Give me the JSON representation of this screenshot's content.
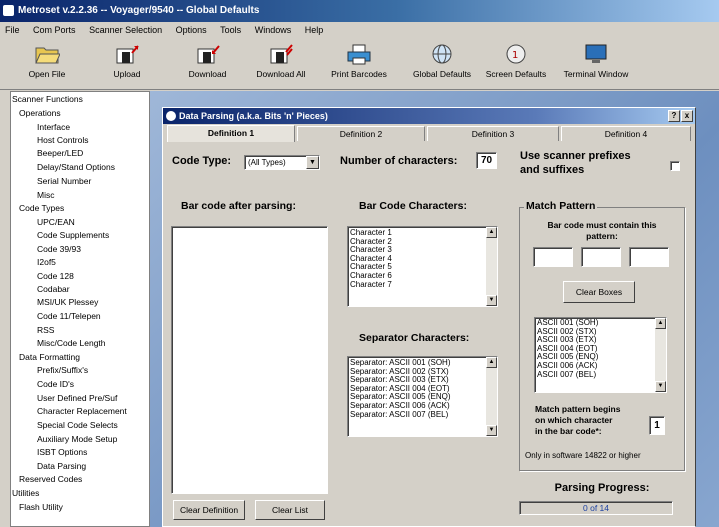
{
  "window": {
    "title": "Metroset v.2.2.36 -- Voyager/9540 -- Global Defaults"
  },
  "menu": [
    "File",
    "Com Ports",
    "Scanner Selection",
    "Options",
    "Tools",
    "Windows",
    "Help"
  ],
  "toolbar": {
    "open_file": "Open File",
    "upload": "Upload",
    "download": "Download",
    "download_all": "Download All",
    "print_barcodes": "Print Barcodes",
    "global_defaults": "Global Defaults",
    "screen_defaults": "Screen Defaults",
    "terminal_window": "Terminal Window"
  },
  "tree": [
    "Scanner Functions",
    "Operations",
    "Interface",
    "Host Controls",
    "Beeper/LED",
    "Delay/Stand Options",
    "Serial Number",
    "Misc",
    "Code Types",
    "UPC/EAN",
    "Code Supplements",
    "Code 39/93",
    "I2of5",
    "Code 128",
    "Codabar",
    "MSI/UK Plessey",
    "Code 11/Telepen",
    "RSS",
    "Misc/Code Length",
    "Data Formatting",
    "Prefix/Suffix's",
    "Code ID's",
    "User Defined Pre/Suf",
    "Character Replacement",
    "Special Code Selects",
    "Auxiliary Mode Setup",
    "ISBT Options",
    "Data Parsing",
    "Reserved Codes",
    "Utilities",
    "Flash Utility"
  ],
  "dialog": {
    "title": "Data Parsing (a.k.a. Bits 'n' Pieces)",
    "help_btn": "?",
    "close_btn": "x",
    "tabs": [
      "Definition 1",
      "Definition 2",
      "Definition 3",
      "Definition 4"
    ],
    "code_type_label": "Code Type:",
    "code_type_value": "(All Types)",
    "num_chars_label": "Number of characters:",
    "num_chars_value": "70",
    "prefix_label_1": "Use scanner prefixes",
    "prefix_label_2": "and suffixes",
    "after_parsing_label": "Bar code after parsing:",
    "bar_code_chars_label": "Bar Code Characters:",
    "characters": [
      "Character 1",
      "Character 2",
      "Character 3",
      "Character 4",
      "Character 5",
      "Character 6",
      "Character 7"
    ],
    "separator_label": "Separator Characters:",
    "separators": [
      "Separator: ASCII 001  (SOH)",
      "Separator: ASCII 002  (STX)",
      "Separator: ASCII 003  (ETX)",
      "Separator: ASCII 004  (EOT)",
      "Separator: ASCII 005  (ENQ)",
      "Separator: ASCII 006  (ACK)",
      "Separator: ASCII 007  (BEL)"
    ],
    "clear_definition": "Clear Definition",
    "clear_list": "Clear List",
    "match_pattern_label": "Match Pattern",
    "must_contain_1": "Bar code must contain this",
    "must_contain_2": "pattern:",
    "clear_boxes": "Clear Boxes",
    "ascii_list": [
      "ASCII 001  (SOH)",
      "ASCII 002  (STX)",
      "ASCII 003  (ETX)",
      "ASCII 004  (EOT)",
      "ASCII 005  (ENQ)",
      "ASCII 006  (ACK)",
      "ASCII 007  (BEL)"
    ],
    "begins_1": "Match pattern begins",
    "begins_2": "on which character",
    "begins_3": "in the bar code*:",
    "begins_value": "1",
    "software_note": "Only in software 14822 or higher",
    "progress_label": "Parsing Progress:",
    "progress_value": "0 of 14"
  }
}
